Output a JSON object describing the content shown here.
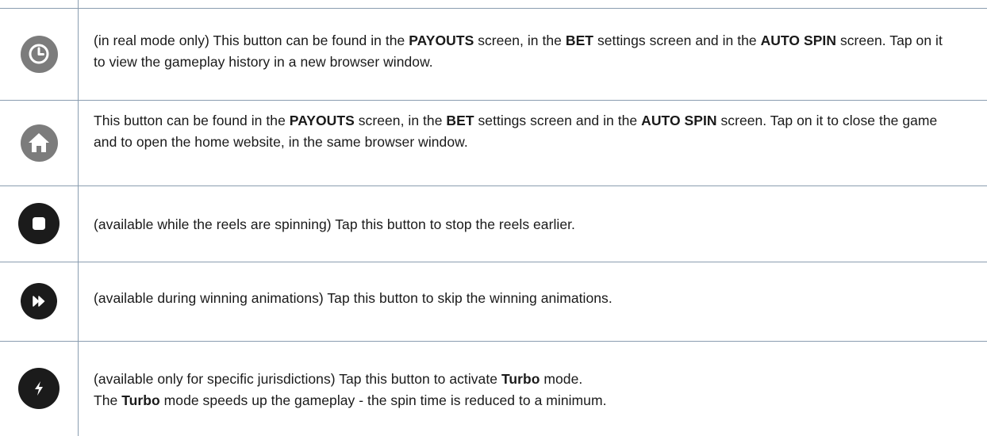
{
  "rows": [
    {
      "icon": "history-clock-icon",
      "text_parts": [
        {
          "t": "(in real mode only) This button can be found in the "
        },
        {
          "t": "PAYOUTS",
          "b": true
        },
        {
          "t": " screen, in the "
        },
        {
          "t": "BET",
          "b": true
        },
        {
          "t": " settings screen and in the "
        },
        {
          "t": "AUTO SPIN",
          "b": true
        },
        {
          "t": " screen. Tap on it to view the gameplay history in a new browser window."
        }
      ]
    },
    {
      "icon": "home-icon",
      "text_parts": [
        {
          "t": "This button can be found in the "
        },
        {
          "t": "PAYOUTS",
          "b": true
        },
        {
          "t": " screen, in the "
        },
        {
          "t": "BET",
          "b": true
        },
        {
          "t": " settings screen and in the "
        },
        {
          "t": "AUTO SPIN",
          "b": true
        },
        {
          "t": " screen. Tap on it to close the game and to open the home website, in the same browser window."
        }
      ]
    },
    {
      "icon": "stop-icon",
      "text_parts": [
        {
          "t": "(available while the reels are spinning) Tap this button to stop the reels earlier."
        }
      ]
    },
    {
      "icon": "skip-animation-icon",
      "text_parts": [
        {
          "t": "(available during winning animations) Tap this button to skip the winning animations."
        }
      ]
    },
    {
      "icon": "turbo-lightning-icon",
      "text_parts": [
        {
          "t": "(available only for specific jurisdictions) Tap this button to activate "
        },
        {
          "t": "Turbo",
          "b": true
        },
        {
          "t": " mode."
        },
        {
          "br": true
        },
        {
          "t": "The "
        },
        {
          "t": "Turbo",
          "b": true
        },
        {
          "t": " mode speeds up the gameplay - the spin time is reduced to a minimum."
        }
      ]
    }
  ]
}
